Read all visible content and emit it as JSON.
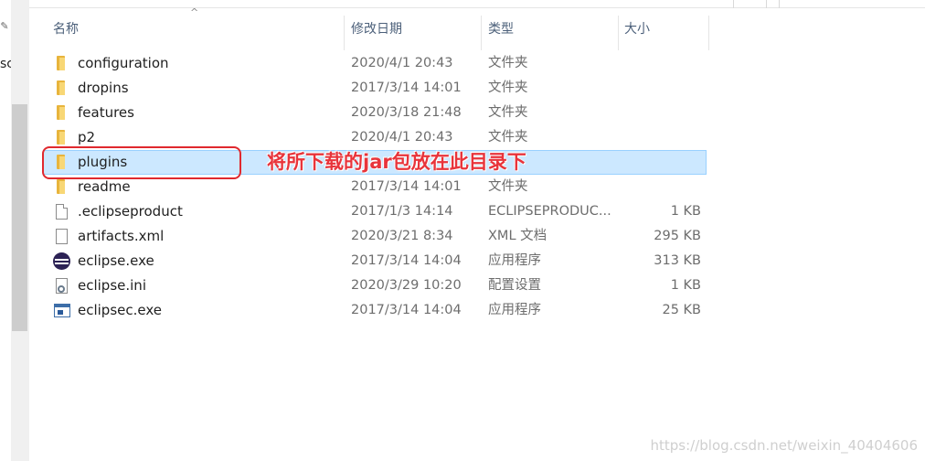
{
  "navigation": {
    "partial_text": "sc",
    "pin_glyph": "✎"
  },
  "columns": {
    "name": "名称",
    "date_modified": "修改日期",
    "type": "类型",
    "size": "大小",
    "sort_indicator": "^"
  },
  "files": [
    {
      "name": "configuration",
      "date": "2020/4/1 20:43",
      "type": "文件夹",
      "size": "",
      "icon": "folder-icon"
    },
    {
      "name": "dropins",
      "date": "2017/3/14 14:01",
      "type": "文件夹",
      "size": "",
      "icon": "folder-icon"
    },
    {
      "name": "features",
      "date": "2020/3/18 21:48",
      "type": "文件夹",
      "size": "",
      "icon": "folder-icon"
    },
    {
      "name": "p2",
      "date": "2020/4/1 20:43",
      "type": "文件夹",
      "size": "",
      "icon": "folder-icon"
    },
    {
      "name": "plugins",
      "date": "",
      "type": "",
      "size": "",
      "icon": "folder-icon",
      "selected": true
    },
    {
      "name": "readme",
      "date": "2017/3/14 14:01",
      "type": "文件夹",
      "size": "",
      "icon": "folder-icon"
    },
    {
      "name": ".eclipseproduct",
      "date": "2017/1/3 14:14",
      "type": "ECLIPSEPRODUC...",
      "size": "1 KB",
      "icon": "file-icon"
    },
    {
      "name": "artifacts.xml",
      "date": "2020/3/21 8:34",
      "type": "XML 文档",
      "size": "295 KB",
      "icon": "xml-file-icon"
    },
    {
      "name": "eclipse.exe",
      "date": "2017/3/14 14:04",
      "type": "应用程序",
      "size": "313 KB",
      "icon": "eclipse-icon"
    },
    {
      "name": "eclipse.ini",
      "date": "2020/3/29 10:20",
      "type": "配置设置",
      "size": "1 KB",
      "icon": "settings-file-icon"
    },
    {
      "name": "eclipsec.exe",
      "date": "2017/3/14 14:04",
      "type": "应用程序",
      "size": "25 KB",
      "icon": "application-icon"
    }
  ],
  "annotation": {
    "text": "将所下载的jar包放在此目录下",
    "color": "#e8343b"
  },
  "watermark": "https://blog.csdn.net/weixin_40404606",
  "colors": {
    "selection_bg": "#cce8ff",
    "selection_border": "#99d1ff",
    "folder": "#f8d775",
    "header_text": "#4c607a"
  }
}
